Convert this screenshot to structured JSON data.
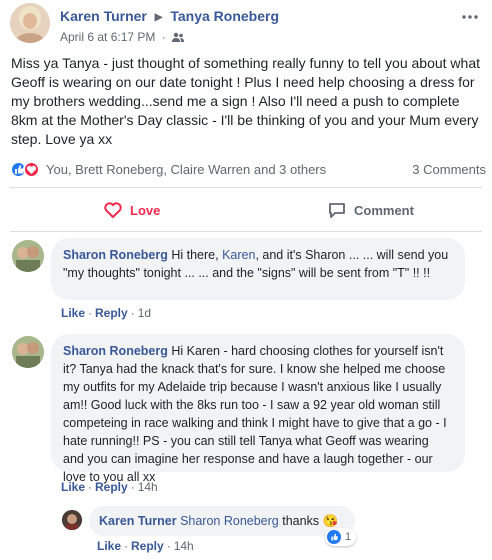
{
  "post": {
    "author": "Karen Turner",
    "recipient": "Tanya Roneberg",
    "timestamp": "April 6 at 6:17 PM",
    "audience_icon": "friends-icon",
    "menu_icon": "more-dots-icon",
    "text": "Miss ya Tanya - just thought of something really funny to tell you about what Geoff is wearing on our date tonight ! Plus I need help choosing a dress for my brothers wedding...send me a sign ! Also I'll need a push to complete 8km at the Mother's Day classic - I'll be thinking of you and your Mum every step. Love ya xx"
  },
  "reactions": {
    "names": "You, Brett Roneberg, Claire Warren and 3 others",
    "comment_count": "3 Comments",
    "like_color": "#2078f4",
    "love_color": "#f0284a"
  },
  "actions": {
    "love_label": "Love",
    "comment_label": "Comment"
  },
  "comments": [
    {
      "author": "Sharon Roneberg",
      "text_before": "Hi there, ",
      "mention": "Karen",
      "text_after": ", and it's Sharon ... ... will send you \"my thoughts\" tonight ... ... and the \"signs\" will be sent from \"T\" !! !!",
      "like": "Like",
      "reply": "Reply",
      "time": "1d"
    },
    {
      "author": "Sharon Roneberg",
      "text": "Hi Karen - hard choosing clothes for yourself isn't it? Tanya had the knack that's for sure. I know she helped me choose my outfits for my Adelaide trip because I wasn't anxious like I usually am!! Good luck with the 8ks run too - I saw a 92 year old woman still competeing in race walking and think I might have to give that a go - I hate running!! PS - you can still tell Tanya what Geoff was wearing and you can imagine her response and have a laugh together - our love to you all xx",
      "like": "Like",
      "reply": "Reply",
      "time": "14h"
    }
  ],
  "reply": {
    "author": "Karen Turner",
    "mention": "Sharon Roneberg",
    "text": "thanks",
    "emoji": "😘",
    "like": "Like",
    "reply": "Reply",
    "time": "14h",
    "reaction_count": "1"
  }
}
